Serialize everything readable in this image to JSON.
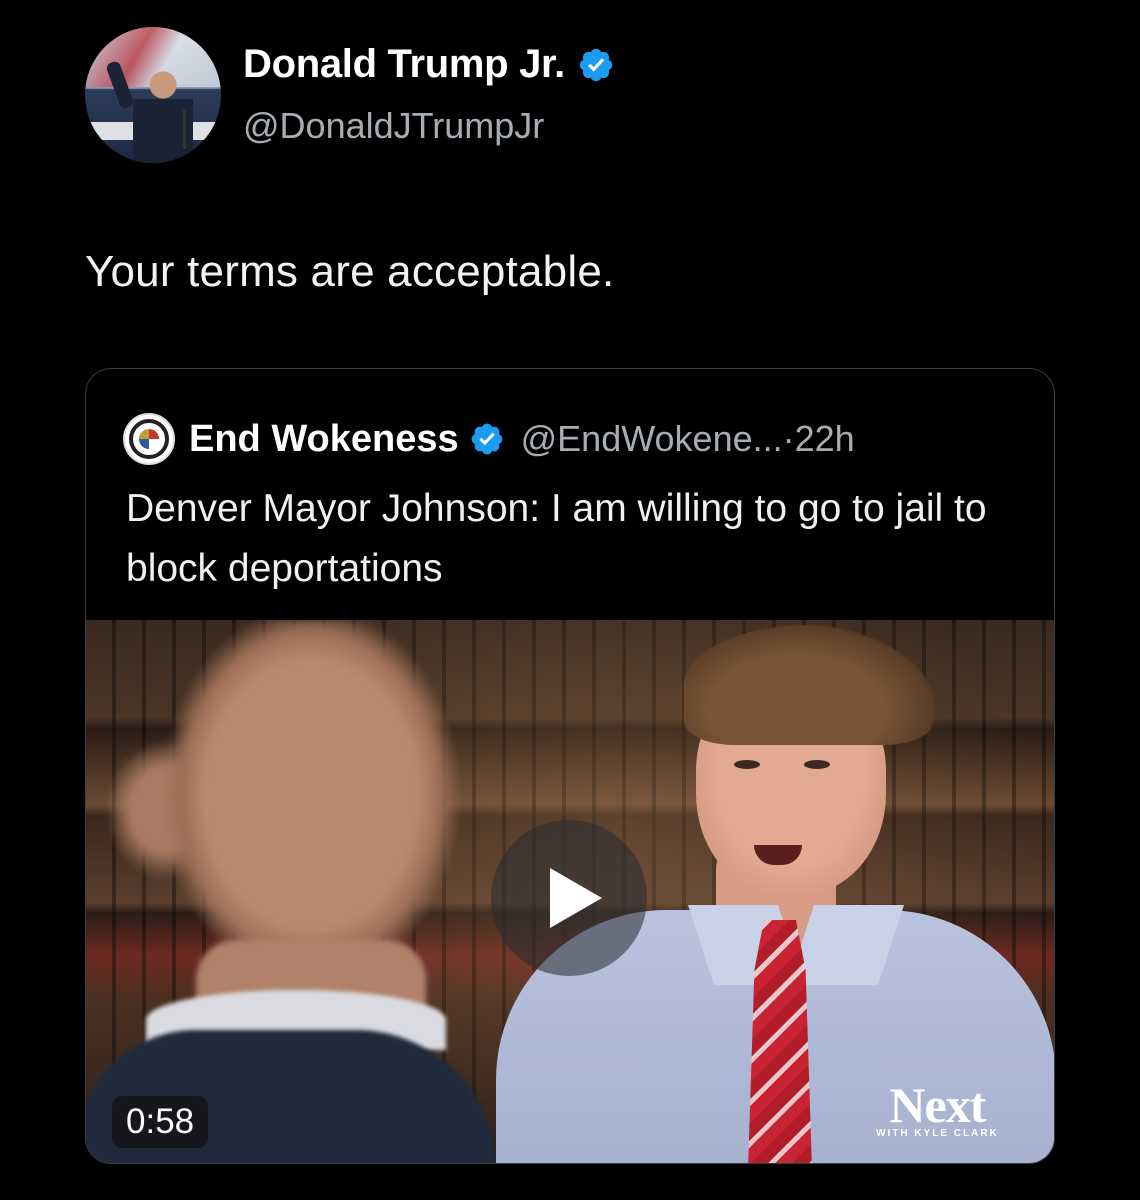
{
  "author": {
    "display_name": "Donald Trump Jr.",
    "handle": "@DonaldJTrumpJr",
    "verified": true
  },
  "tweet": {
    "text": "Your terms are acceptable."
  },
  "quoted_tweet": {
    "display_name": "End Wokeness",
    "handle": "@EndWokene...",
    "separator": "·",
    "time": "22h",
    "verified": true,
    "text": "Denver Mayor Johnson: I am willing to go to jail to block deportations",
    "video": {
      "duration": "0:58",
      "watermark_main": "Next",
      "watermark_sub": "WITH KYLE CLARK"
    }
  },
  "colors": {
    "background": "#000000",
    "verified_badge": "#1d9bf0",
    "secondary_text": "#a8adb3",
    "card_border": "#3a3d41"
  },
  "icons": {
    "verified": "verified-badge-icon",
    "play": "play-icon"
  }
}
